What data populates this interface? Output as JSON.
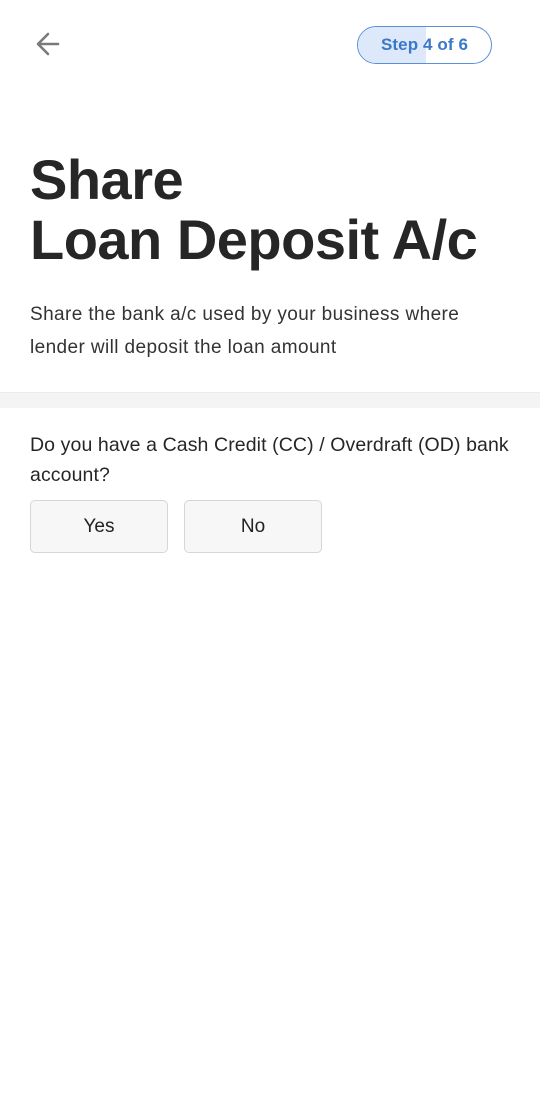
{
  "header": {
    "back_icon": "arrow-left-icon",
    "step_label": "Step 4 of 6",
    "step_progress": 0.51,
    "accent_color": "#3a78c9"
  },
  "hero": {
    "title_line1": "Share",
    "title_line2": "Loan Deposit A/c",
    "subtitle": "Share the bank a/c used by your business where lender will deposit the loan amount"
  },
  "question": {
    "text": "Do you have a Cash Credit (CC) / Overdraft (OD) bank account?",
    "options": [
      {
        "label": "Yes"
      },
      {
        "label": "No"
      }
    ]
  }
}
